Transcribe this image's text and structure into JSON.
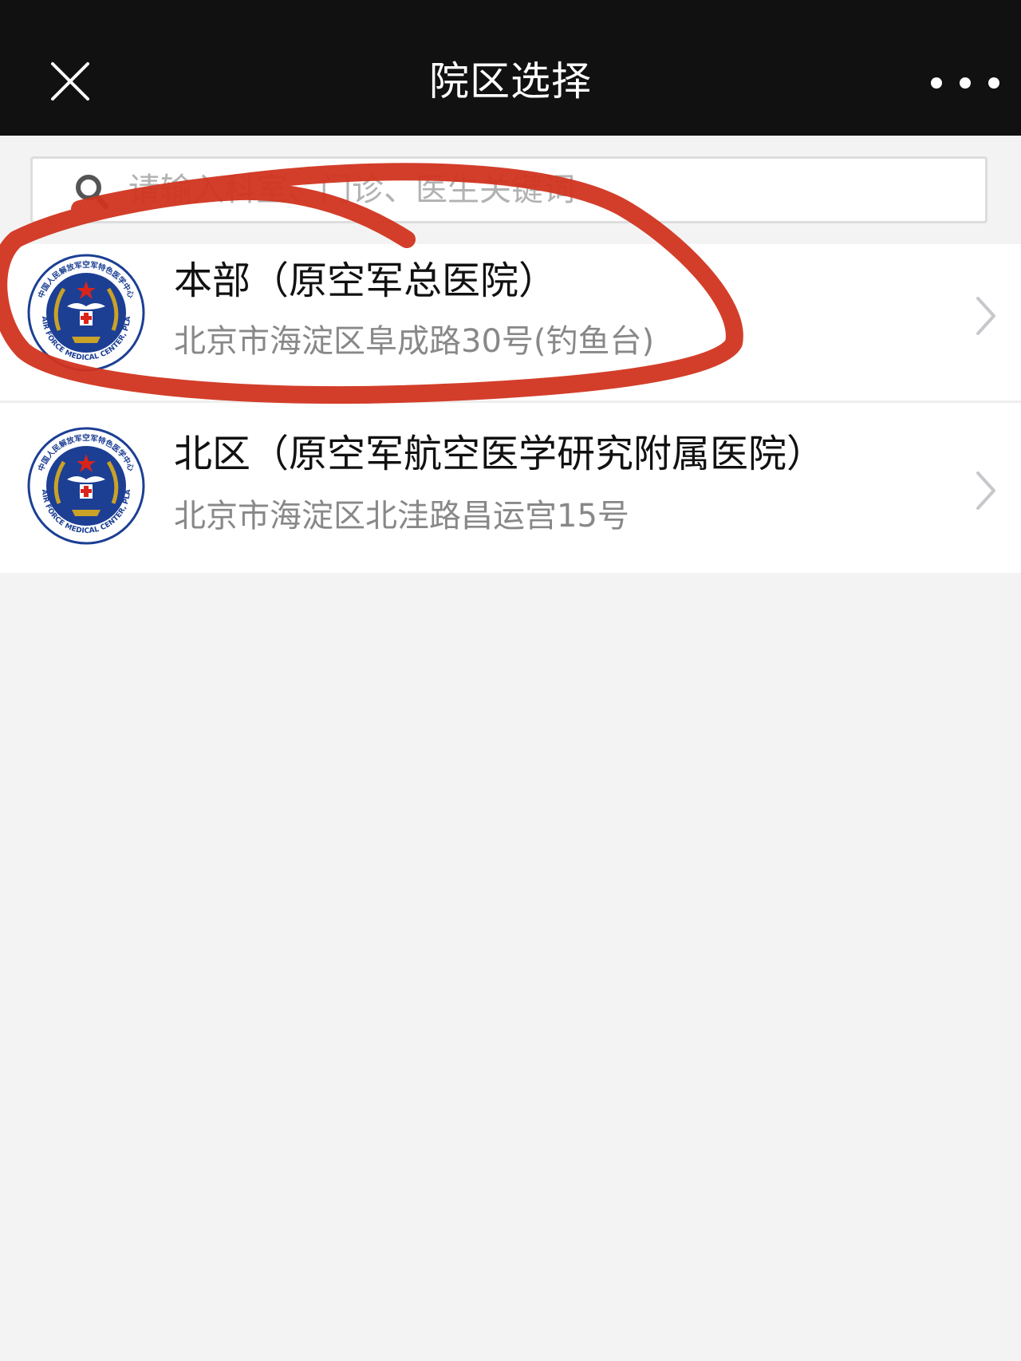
{
  "nav": {
    "title": "院区选择",
    "close_icon": "close-icon",
    "more_icon": "more-icon"
  },
  "search": {
    "placeholder": "请输入科室、门诊、医生关键词",
    "value": ""
  },
  "campuses": [
    {
      "name": "本部（原空军总医院）",
      "address": "北京市海淀区阜成路30号(钓鱼台)",
      "logo": {
        "top_text": "中国人民解放军空军特色医学中心",
        "bottom_text": "AIR FORCE MEDICAL CENTER, PLA"
      }
    },
    {
      "name": "北区（原空军航空医学研究附属医院）",
      "address": "北京市海淀区北洼路昌运宫15号",
      "logo": {
        "top_text": "中国人民解放军空军特色医学中心",
        "bottom_text": "AIR FORCE MEDICAL CENTER, PLA"
      }
    }
  ],
  "colors": {
    "nav_background": "#111111",
    "page_background": "#f3f3f3",
    "annotation": "#d1341f",
    "logo_blue": "#1c3f94",
    "logo_gold": "#c9a227"
  }
}
